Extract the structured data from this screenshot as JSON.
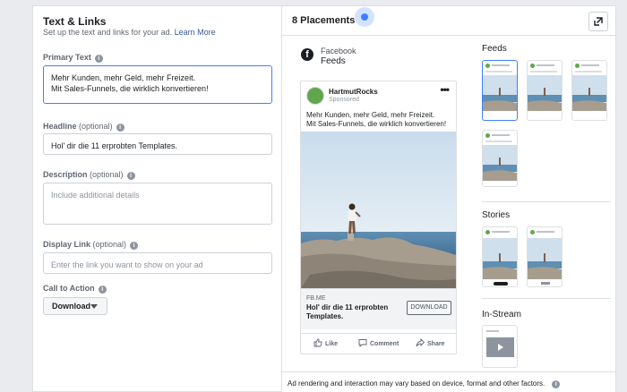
{
  "left_panel": {
    "title": "Text & Links",
    "subtitle": "Set up the text and links for your ad.",
    "learn_more": "Learn More",
    "primary_text": {
      "label": "Primary Text",
      "value_line1": "Mehr Kunden, mehr Geld, mehr Freizeit.",
      "value_line2": "Mit Sales-Funnels, die wirklich konvertieren!"
    },
    "headline": {
      "label": "Headline",
      "optional": "(optional)",
      "value": "Hol' dir die 11 erprobten Templates."
    },
    "description": {
      "label": "Description",
      "optional": "(optional)",
      "placeholder": "Include additional details"
    },
    "display_link": {
      "label": "Display Link",
      "optional": "(optional)",
      "placeholder": "Enter the link you want to show on your ad"
    },
    "cta": {
      "label": "Call to Action",
      "value": "Download"
    }
  },
  "right_panel": {
    "placements_title": "8 Placements",
    "platform": "Facebook",
    "placement_name": "Feeds",
    "preview": {
      "page_name": "HartmutRocks",
      "sponsored": "Sponsored",
      "text_line1": "Mehr Kunden, mehr Geld, mehr Freizeit.",
      "text_line2": "Mit Sales-Funnels, die wirklich konvertieren!",
      "link_domain": "FB.ME",
      "link_headline": "Hol' dir die 11 erprobten Templates.",
      "cta_button": "DOWNLOAD",
      "actions": [
        "Like",
        "Comment",
        "Share"
      ]
    },
    "groups": {
      "feeds": "Feeds",
      "stories": "Stories",
      "instream": "In-Stream"
    },
    "footer_note": "Ad rendering and interaction may vary based on device, format and other factors."
  },
  "colors": {
    "accent": "#4080ff",
    "link": "#385898",
    "panel_bg": "#ffffff",
    "page_bg": "#e9ebee"
  },
  "icons": [
    "info-icon",
    "caret-down-icon",
    "expand-icon",
    "facebook-logo-icon",
    "more-icon",
    "like-icon",
    "comment-icon",
    "share-icon"
  ]
}
